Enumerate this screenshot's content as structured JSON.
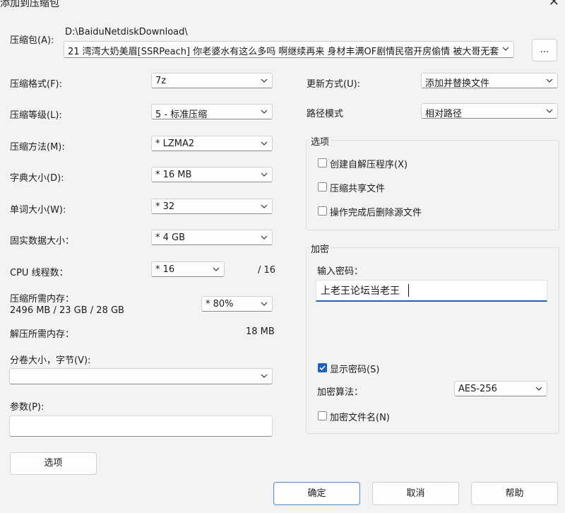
{
  "window": {
    "title": "添加到压缩包",
    "close_glyph": "✕"
  },
  "archive": {
    "label": "压缩包(A):",
    "path": "D:\\BaiduNetdiskDownload\\",
    "name": "21 湾湾大奶美眉[SSRPeach] 你老婆水有这么多吗 啊继续再来 身材丰满OF剧情民宿开房偷情 被大哥无套",
    "browse_label": "..."
  },
  "left": {
    "format": {
      "label": "压缩格式(F):",
      "value": "7z"
    },
    "level": {
      "label": "压缩等级(L):",
      "value": "5 - 标准压缩"
    },
    "method": {
      "label": "压缩方法(M):",
      "value": "*  LZMA2"
    },
    "dict": {
      "label": "字典大小(D):",
      "value": "*  16 MB"
    },
    "word": {
      "label": "单词大小(W):",
      "value": "*  32"
    },
    "solid": {
      "label": "固实数据大小：",
      "value": "*  4 GB"
    },
    "threads": {
      "label": "CPU 线程数：",
      "value": "*  16",
      "max": "/ 16"
    },
    "mem_compress": {
      "label": "压缩所需内存：",
      "detail": "2496 MB / 23 GB / 28 GB",
      "value": "*  80%"
    },
    "mem_decompress": {
      "label": "解压所需内存：",
      "value": "18 MB"
    },
    "volume": {
      "label": "分卷大小，字节(V):",
      "value": ""
    },
    "params": {
      "label": "参数(P):",
      "value": ""
    },
    "options_button": "选项"
  },
  "right": {
    "update": {
      "label": "更新方式(U):",
      "value": "添加并替换文件"
    },
    "pathmode": {
      "label": "路径模式",
      "value": "相对路径"
    },
    "options_group": {
      "title": "选项",
      "items": [
        {
          "label": "创建自解压程序(X)",
          "checked": false
        },
        {
          "label": "压缩共享文件",
          "checked": false
        },
        {
          "label": "操作完成后删除源文件",
          "checked": false
        }
      ]
    },
    "encryption": {
      "title": "加密",
      "password_label": "输入密码：",
      "password_value": "上老王论坛当老王",
      "show_password": {
        "label": "显示密码(S)",
        "checked": true
      },
      "method_label": "加密算法：",
      "method_value": "AES-256",
      "encrypt_names": {
        "label": "加密文件名(N)",
        "checked": false
      }
    }
  },
  "footer": {
    "ok": "确定",
    "cancel": "取消",
    "help": "帮助"
  },
  "icons": {
    "dropdown": "chevron-down-icon",
    "check": "checkmark-icon"
  },
  "colors": {
    "accent": "#1f5fbf",
    "background": "#f3f3f3"
  }
}
